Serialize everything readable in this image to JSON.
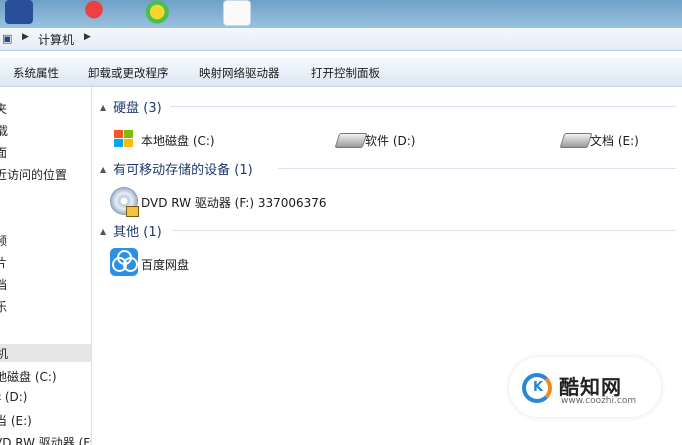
{
  "address_bar": {
    "crumb": "计算机"
  },
  "toolbar": {
    "buttons": [
      "系统属性",
      "卸载或更改程序",
      "映射网络驱动器",
      "打开控制面板"
    ]
  },
  "sidebar": {
    "items": [
      {
        "label": "夹",
        "selected": false
      },
      {
        "label": "载",
        "selected": false
      },
      {
        "label": "面",
        "selected": false
      },
      {
        "label": "近访问的位置",
        "selected": false
      },
      {
        "label": "频",
        "selected": false
      },
      {
        "label": "片",
        "selected": false
      },
      {
        "label": "档",
        "selected": false
      },
      {
        "label": "乐",
        "selected": false
      },
      {
        "label": "机",
        "selected": true
      },
      {
        "label": "地磁盘 (C:)",
        "selected": false
      },
      {
        "label": "‡ (D:)",
        "selected": false
      },
      {
        "label": "当 (E:)",
        "selected": false
      },
      {
        "label": "VD RW 驱动器 (F:)",
        "selected": false
      }
    ]
  },
  "groups": {
    "hard_disks": {
      "title": "硬盘 (3)",
      "items": [
        "本地磁盘 (C:)",
        "软件 (D:)",
        "文档 (E:)"
      ]
    },
    "removable": {
      "title": "有可移动存储的设备 (1)",
      "items": [
        "DVD RW 驱动器 (F:) 337006376"
      ]
    },
    "other": {
      "title": "其他 (1)",
      "items": [
        "百度网盘"
      ]
    }
  },
  "watermark": {
    "name": "酷知网",
    "url": "www.coozhi.com",
    "logo_letter": "K"
  },
  "icons": {
    "computer": "computer-icon",
    "windows_drive": "windows-drive-icon",
    "drive": "hard-drive-icon",
    "dvd": "dvd-drive-icon",
    "baidu": "baidu-netdisk-icon"
  },
  "colors": {
    "group_header": "#1e3a6e",
    "chrome": "#6ea0c8",
    "selection": "#e6e6e6"
  }
}
